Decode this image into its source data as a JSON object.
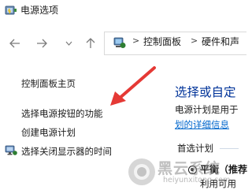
{
  "window": {
    "title": "电源选项"
  },
  "nav": {
    "back_icon": "arrow-left-icon",
    "forward_icon": "arrow-right-icon",
    "recent_icon": "chevron-down-icon",
    "up_icon": "arrow-up-icon"
  },
  "address": {
    "icon": "control-panel-icon",
    "crumbs": [
      "控制面板",
      "硬件和声"
    ]
  },
  "sidebar": {
    "items": [
      {
        "label": "控制面板主页"
      },
      {
        "label": "选择电源按钮的功能"
      },
      {
        "label": "创建电源计划"
      },
      {
        "label": "选择关闭显示器的时间",
        "icon": "display-power-icon"
      }
    ]
  },
  "annotation": {
    "arrow_color": "#e53935"
  },
  "main": {
    "heading": "选择或自定",
    "desc_line1": "电源计划是用于",
    "desc_link": "划的详细信息",
    "section_label": "首选计划",
    "plan": {
      "name": "平衡（推荐",
      "desc": "利用可用"
    }
  },
  "watermark": {
    "brand": "黑云系统",
    "url": "heiyunxitong.com"
  },
  "colors": {
    "heading": "#003399",
    "link": "#0066cc",
    "accent_green": "#2e7d32"
  }
}
